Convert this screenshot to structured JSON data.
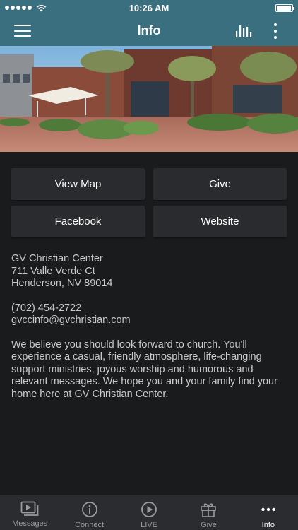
{
  "status_bar": {
    "time": "10:26 AM",
    "battery_level": 0.95
  },
  "header": {
    "title": "Info"
  },
  "buttons": [
    {
      "label": "View Map"
    },
    {
      "label": "Give"
    },
    {
      "label": "Facebook"
    },
    {
      "label": "Website"
    }
  ],
  "contact": {
    "name": "GV Christian Center",
    "street": "711 Valle Verde Ct",
    "city": "Henderson, NV 89014",
    "phone": "(702) 454-2722",
    "email": "gvccinfo@gvchristian.com"
  },
  "description": "We believe you should look forward to church. You'll experience a casual, friendly atmosphere, life-changing support ministries, joyous worship and humorous and relevant messages. We hope you and your family find your home here at GV Christian Center.",
  "tabs": [
    {
      "label": "Messages",
      "icon": "video-icon"
    },
    {
      "label": "Connect",
      "icon": "info-circle-icon"
    },
    {
      "label": "LIVE",
      "icon": "play-circle-icon"
    },
    {
      "label": "Give",
      "icon": "gift-icon"
    },
    {
      "label": "Info",
      "icon": "more-icon",
      "active": true
    }
  ],
  "colors": {
    "header": "#3a6f80",
    "background": "#1a1b1d",
    "button": "#2a2b2e",
    "tab_bar": "#2b2c2f"
  }
}
